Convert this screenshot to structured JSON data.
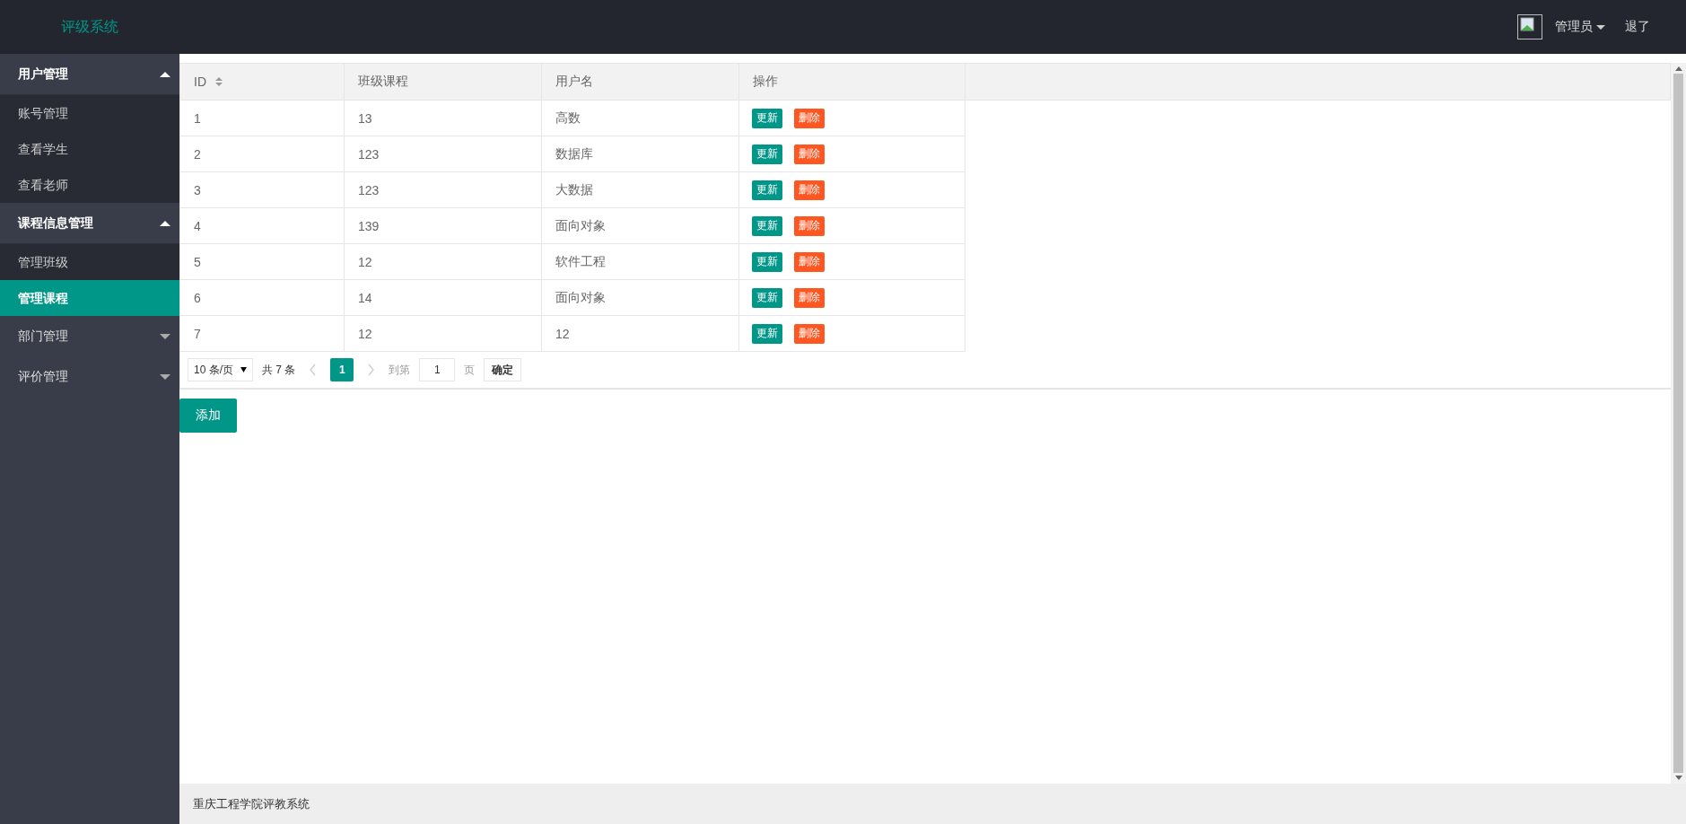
{
  "header": {
    "logo": "评级系统",
    "user": "管理员",
    "logout": "退了"
  },
  "sidebar": {
    "groups": [
      {
        "label": "用户管理",
        "expanded": true,
        "items": [
          {
            "label": "账号管理",
            "selected": false
          },
          {
            "label": "查看学生",
            "selected": false
          },
          {
            "label": "查看老师",
            "selected": false
          }
        ]
      },
      {
        "label": "课程信息管理",
        "expanded": true,
        "items": [
          {
            "label": "管理班级",
            "selected": false
          },
          {
            "label": "管理课程",
            "selected": true
          }
        ]
      },
      {
        "label": "部门管理",
        "expanded": false
      },
      {
        "label": "评价管理",
        "expanded": false
      }
    ]
  },
  "table": {
    "columns": [
      {
        "label": "ID",
        "sortable": true
      },
      {
        "label": "班级课程",
        "sortable": false
      },
      {
        "label": "用户名",
        "sortable": false
      },
      {
        "label": "操作",
        "sortable": false
      }
    ],
    "rows": [
      {
        "cells": [
          "1",
          "13",
          "高数"
        ],
        "actions": [
          {
            "label": "更新",
            "kind": "primary"
          },
          {
            "label": "删除",
            "kind": "danger"
          }
        ]
      },
      {
        "cells": [
          "2",
          "123",
          "数据库"
        ],
        "actions": [
          {
            "label": "更新",
            "kind": "primary"
          },
          {
            "label": "删除",
            "kind": "danger"
          }
        ]
      },
      {
        "cells": [
          "3",
          "123",
          "大数据"
        ],
        "actions": [
          {
            "label": "更新",
            "kind": "primary"
          },
          {
            "label": "删除",
            "kind": "danger"
          }
        ]
      },
      {
        "cells": [
          "4",
          "139",
          "面向对象"
        ],
        "actions": [
          {
            "label": "更新",
            "kind": "primary"
          },
          {
            "label": "删除",
            "kind": "danger"
          }
        ]
      },
      {
        "cells": [
          "5",
          "12",
          "软件工程"
        ],
        "actions": [
          {
            "label": "更新",
            "kind": "primary"
          },
          {
            "label": "删除",
            "kind": "danger"
          }
        ]
      },
      {
        "cells": [
          "6",
          "14",
          "面向对象"
        ],
        "actions": [
          {
            "label": "更新",
            "kind": "primary"
          },
          {
            "label": "删除",
            "kind": "danger"
          }
        ]
      },
      {
        "cells": [
          "7",
          "12",
          "12"
        ],
        "actions": [
          {
            "label": "更新",
            "kind": "primary"
          },
          {
            "label": "删除",
            "kind": "danger"
          }
        ]
      }
    ]
  },
  "pagination": {
    "page_size": "10 条/页",
    "total": "共 7 条",
    "pages": [
      {
        "label": "1",
        "selected": true
      }
    ],
    "goto_label": "到第",
    "goto_value": "1",
    "page_unit": "页",
    "confirm": "确定"
  },
  "add_button": "添加",
  "footer": "重庆工程学院评教系统"
}
